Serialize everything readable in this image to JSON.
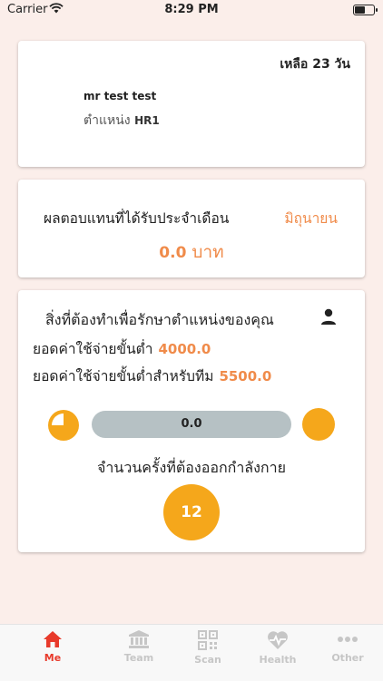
{
  "status_bar": {
    "carrier": "Carrier",
    "time": "8:29 PM",
    "battery_level": 0.6
  },
  "profile": {
    "days_remaining": "เหลือ 23 วัน",
    "name": "mr test test",
    "position_label": "ตำแหน่ง",
    "position_value": "HR1"
  },
  "income": {
    "title": "ผลตอบแทนที่ได้รับประจำเดือน",
    "month": "มิถุนายน",
    "amount": "0.0",
    "unit": "บาท"
  },
  "tasks": {
    "title": "สิ่งที่ต้องทำเพื่อรักษาตำแหน่งของคุณ",
    "min_spend_label": "ยอดค่าใช้จ่ายขั้นต่ำ",
    "min_spend_value": "4000.0",
    "team_min_spend_label": "ยอดค่าใช้จ่ายขั้นต่ำสำหรับทีม",
    "team_min_spend_value": "5500.0",
    "progress_value": "0.0",
    "progress_fraction": 0,
    "exercise_label": "จำนวนครั้งที่ต้องออกกำลังกาย",
    "exercise_count": "12"
  },
  "tabbar": {
    "tabs": [
      {
        "label": "Me",
        "icon": "home-icon",
        "active": true
      },
      {
        "label": "Team",
        "icon": "bank-icon",
        "active": false
      },
      {
        "label": "Scan",
        "icon": "qr-code-icon",
        "active": false
      },
      {
        "label": "Health",
        "icon": "heart-pulse-icon",
        "active": false
      },
      {
        "label": "Other",
        "icon": "more-dots-icon",
        "active": false
      }
    ]
  },
  "colors": {
    "accent": "#f08b4a",
    "orange": "#f5a71b",
    "active_tab": "#e83a2b",
    "inactive_tab": "#c6c6c6",
    "background": "#fbeeea"
  }
}
